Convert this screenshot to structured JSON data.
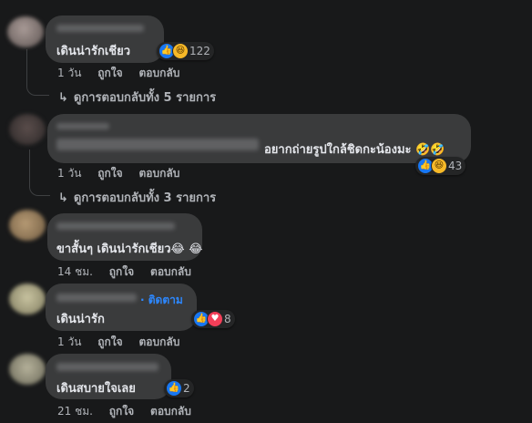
{
  "actions": {
    "like": "ถูกใจ",
    "reply": "ตอบกลับ"
  },
  "icons": {
    "like": "like-icon",
    "laugh": "laugh-icon",
    "love": "love-icon"
  },
  "colors": {
    "background": "#18191a",
    "bubble": "#3a3b3c",
    "like": "#1877f2",
    "love": "#f33e58",
    "link": "#2d88ff"
  },
  "comments": [
    {
      "text": "เดินน่ารักเชียว",
      "time": "1 วัน",
      "reaction_count": "122",
      "replies_label": "ดูการตอบกลับทั้ง 5 รายการ"
    },
    {
      "text": "อยากถ่ายรูปใกล้ชิดกะน้องมะ 🤣🤣",
      "time": "1 วัน",
      "reaction_count": "43",
      "replies_label": "ดูการตอบกลับทั้ง 3 รายการ"
    },
    {
      "text": "ขาสั้นๆ เดินน่ารักเชียว😂 😂",
      "time": "14 ชม."
    },
    {
      "text": "เดินน่ารัก",
      "time": "1 วัน",
      "reaction_count": "8",
      "follow_label": "· ติดตาม"
    },
    {
      "text": "เดินสบายใจเลย",
      "time": "21 ชม.",
      "reaction_count": "2"
    }
  ]
}
